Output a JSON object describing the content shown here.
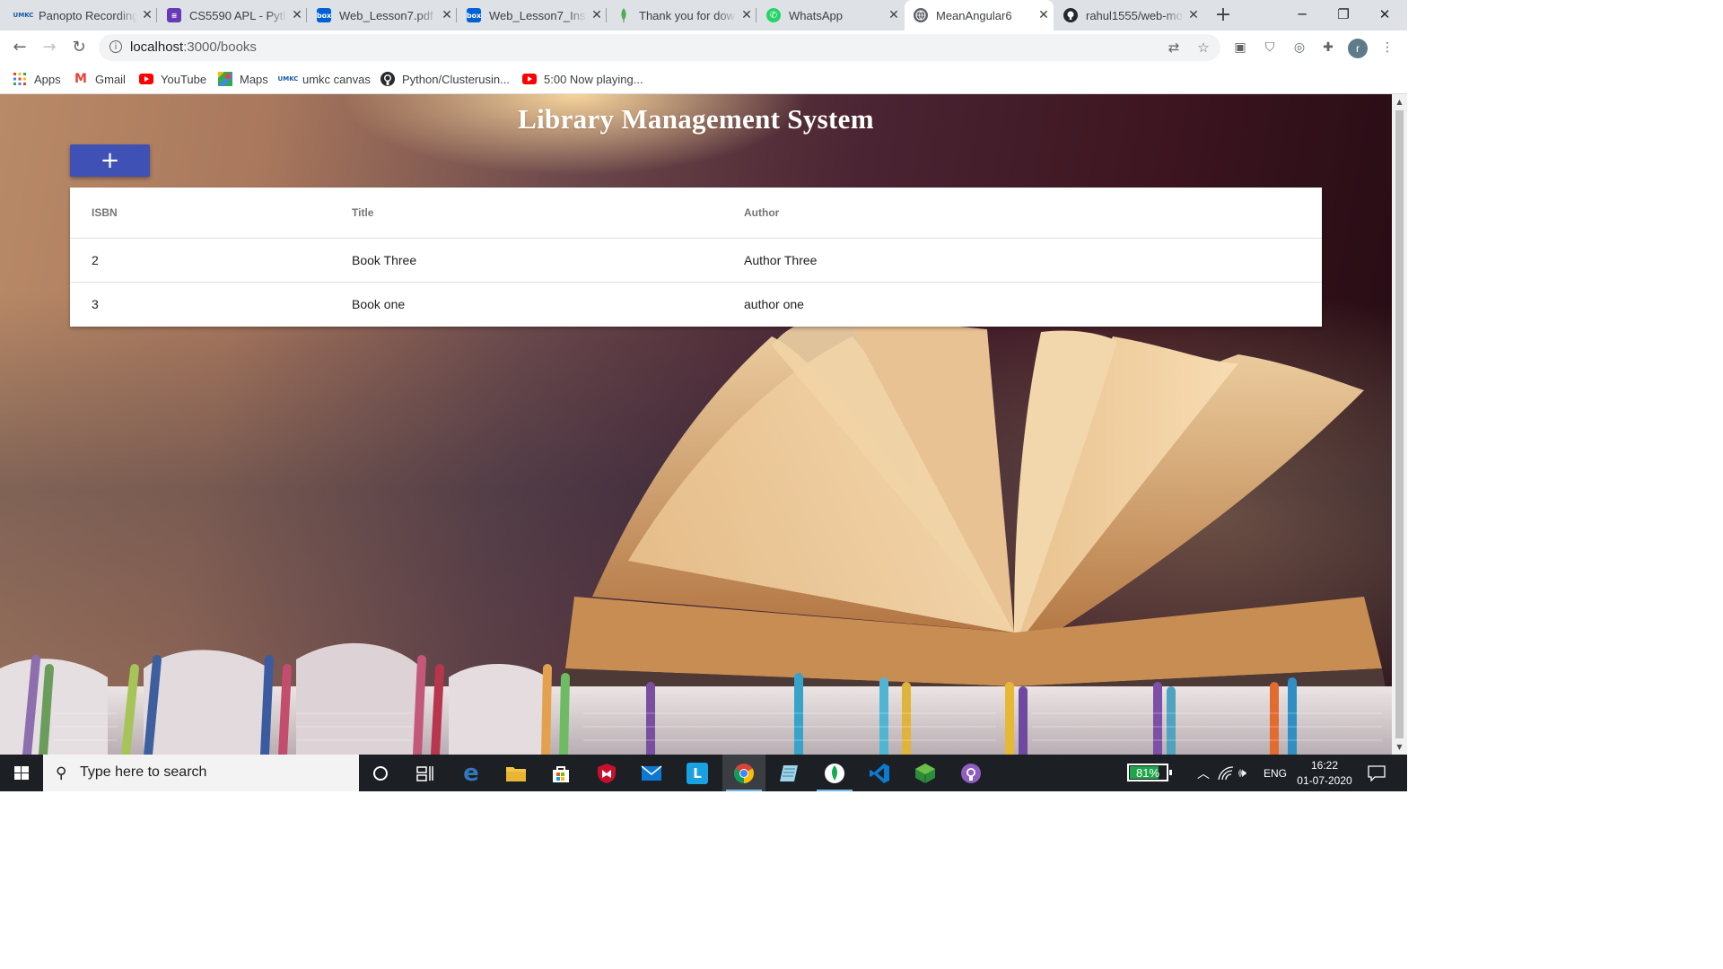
{
  "browser": {
    "tabs": [
      {
        "title": "Panopto Recording",
        "favicon": "umkc-icon",
        "color": "#1a5aa6"
      },
      {
        "title": "CS5590 APL - Pyth",
        "favicon": "document-list-icon",
        "color": "#673ab7"
      },
      {
        "title": "Web_Lesson7.pdf |",
        "favicon": "box-icon",
        "color": "#0061d5"
      },
      {
        "title": "Web_Lesson7_Inst",
        "favicon": "box-icon",
        "color": "#0061d5"
      },
      {
        "title": "Thank you for dow",
        "favicon": "mongodb-leaf-icon",
        "color": "#4caf50"
      },
      {
        "title": "WhatsApp",
        "favicon": "whatsapp-icon",
        "color": "#25d366"
      },
      {
        "title": "MeanAngular6",
        "favicon": "globe-icon",
        "color": "#5f6368",
        "active": true
      },
      {
        "title": "rahul1555/web-mo",
        "favicon": "github-icon",
        "color": "#24292e"
      }
    ],
    "url_host": "localhost",
    "url_path": ":3000/books",
    "profile_initial": "r",
    "bookmarks": [
      {
        "label": "Apps",
        "icon": "apps-grid-icon"
      },
      {
        "label": "Gmail",
        "icon": "gmail-icon"
      },
      {
        "label": "YouTube",
        "icon": "youtube-icon"
      },
      {
        "label": "Maps",
        "icon": "maps-icon"
      },
      {
        "label": "umkc canvas",
        "icon": "umkc-icon"
      },
      {
        "label": "Python/Clusterusin...",
        "icon": "github-icon"
      },
      {
        "label": "5:00 Now playing...",
        "icon": "youtube-icon"
      }
    ]
  },
  "page": {
    "title": "Library Management System",
    "add_label": "+",
    "columns": [
      "ISBN",
      "Title",
      "Author"
    ],
    "rows": [
      {
        "isbn": "2",
        "title": "Book Three",
        "author": "Author Three"
      },
      {
        "isbn": "3",
        "title": "Book one",
        "author": "author one"
      }
    ],
    "accent": "#3f51b5"
  },
  "taskbar": {
    "search_placeholder": "Type here to search",
    "battery": "81%",
    "battery_level": 0.81,
    "language": "ENG",
    "time": "16:22",
    "date": "01-07-2020"
  }
}
